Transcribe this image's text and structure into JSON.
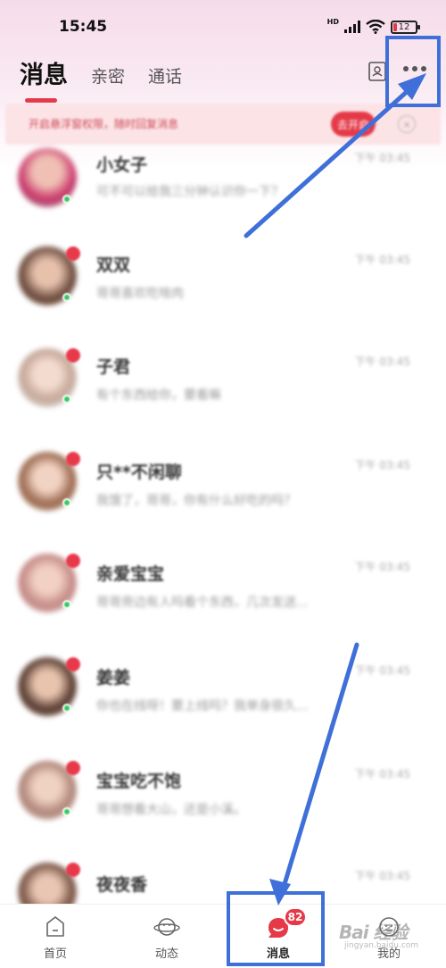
{
  "status_bar": {
    "time": "15:45",
    "hd": "HD",
    "battery": "12"
  },
  "header": {
    "tabs": [
      {
        "label": "消息",
        "active": true
      },
      {
        "label": "亲密",
        "active": false
      },
      {
        "label": "通话",
        "active": false
      }
    ],
    "contact_icon": "contact-card-icon",
    "more_icon": "more-dots-icon"
  },
  "banner": {
    "text": "开启悬浮窗权限，随时回复消息",
    "button": "去开启",
    "close_icon": "close-icon"
  },
  "conversations": [
    {
      "name": "小女子",
      "message": "可不可以给我三分钟认识你一下？",
      "time": "下午 03:45",
      "online": true,
      "badge": false
    },
    {
      "name": "双双",
      "message": "哥哥喜欢吃啥肉",
      "time": "下午 03:45",
      "online": true,
      "badge": true
    },
    {
      "name": "子君",
      "message": "有个东西给你，要看嘛",
      "time": "下午 03:45",
      "online": true,
      "badge": true
    },
    {
      "name": "只**不闲聊",
      "message": "我饿了，哥哥，你有什么好吃的吗？",
      "time": "下午 03:45",
      "online": true,
      "badge": true
    },
    {
      "name": "亲爱宝宝",
      "message": "哥哥旁边有人吗看个东西，几次发送...",
      "time": "下午 03:45",
      "online": true,
      "badge": true
    },
    {
      "name": "姜姜",
      "message": "你也在线呀！要上线吗？我单身很久...",
      "time": "下午 03:45",
      "online": true,
      "badge": true
    },
    {
      "name": "宝宝吃不饱",
      "message": "哥哥想看大山，还是小溪。",
      "time": "下午 03:45",
      "online": true,
      "badge": true
    },
    {
      "name": "夜夜香",
      "message": "",
      "time": "下午 03:45",
      "online": true,
      "badge": true
    }
  ],
  "bottom_nav": [
    {
      "label": "首页",
      "icon": "home-icon"
    },
    {
      "label": "动态",
      "icon": "planet-icon"
    },
    {
      "label": "消息",
      "icon": "message-bubble-icon",
      "active": true
    },
    {
      "label": "我的",
      "icon": "profile-icon"
    }
  ],
  "nav_badge": "82",
  "watermark": {
    "text": "Bai 经验",
    "sub": "jingyan.baidu.com"
  },
  "colors": {
    "accent": "#e53948",
    "annotation": "#3f6fd8",
    "online": "#32c860"
  }
}
